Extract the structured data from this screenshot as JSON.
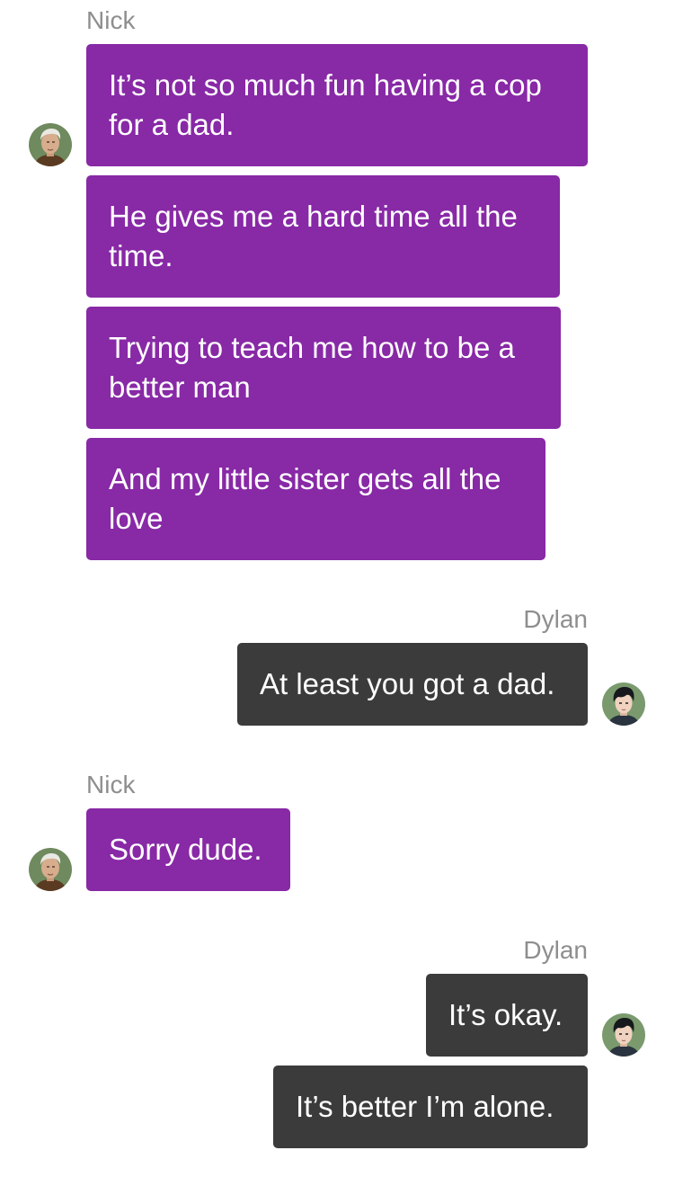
{
  "messages": {
    "g1": {
      "sender": "Nick",
      "b1": "It’s not so much fun having a cop for a dad.",
      "b2": "He gives me a hard time all the time.",
      "b3": "Trying to teach me how to be a better man",
      "b4": "And my little sister gets all the love"
    },
    "g2": {
      "sender": "Dylan",
      "b1": "At least you got a dad."
    },
    "g3": {
      "sender": "Nick",
      "b1": "Sorry dude."
    },
    "g4": {
      "sender": "Dylan",
      "b1": "It’s okay.",
      "b2": "It’s better I’m alone."
    }
  },
  "avatars": {
    "nick": "nick-avatar",
    "dylan": "dylan-avatar"
  },
  "colors": {
    "nick_bubble": "#8829a6",
    "dylan_bubble": "#3b3b3b",
    "sender_name": "#8e8e8e",
    "background": "#ffffff"
  }
}
